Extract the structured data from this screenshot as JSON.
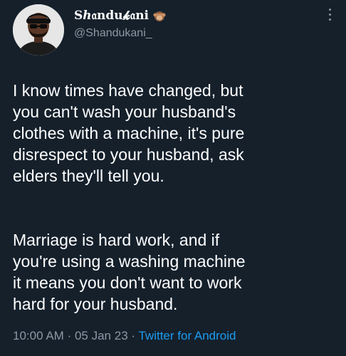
{
  "user": {
    "display_name": "Sℎ𝔞ndu𝓴𝔞ni",
    "handle": "@Shandukani_"
  },
  "tweet": {
    "paragraphs": [
      "I know times have changed, but\nyou can't wash your husband's\nclothes with a machine, it's pure\ndisrespect to your husband, ask\nelders they'll tell you.",
      "Marriage is hard work, and if\nyou're using a washing machine\nit means you don't want to work\nhard for your husband."
    ],
    "time": "10:00 AM",
    "separator": "·",
    "date": "05 Jan 23",
    "source": "Twitter for Android"
  },
  "icons": {
    "avatar": "avatar-image",
    "badge": "monkey-emoji-icon",
    "more": "more-options-icon"
  },
  "colors": {
    "background": "#15202b",
    "text": "#ffffff",
    "muted": "#8b98a5",
    "link": "#1d9bf0"
  }
}
